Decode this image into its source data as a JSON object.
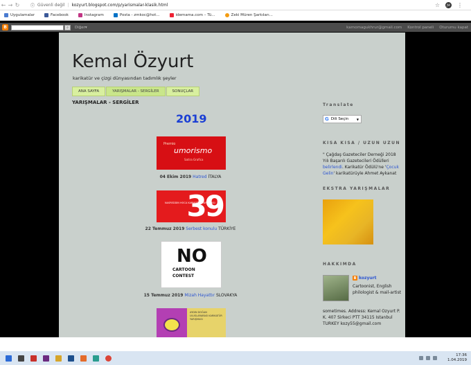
{
  "browser": {
    "security": "Güvenli değil",
    "url": "kozyurt.blogspot.com/p/yarismalar-klasik.html",
    "profile_initials": "JW",
    "bookmarks": [
      "Uygulamalar",
      "Facebook",
      "Instagram",
      "Posta - zmkoc@hot...",
      "idemama.com – Tü...",
      "Zeki Müren Şarkıları..."
    ]
  },
  "navbar": {
    "more": "Diğer",
    "user_email": "karnomagukhrur@gmail.com",
    "control_panel": "Kontrol paneli",
    "sign_out": "Oturumu kapat"
  },
  "blog": {
    "title": "Kemal Özyurt",
    "description": "karikatür ve çizgi dünyasından tadımlık şeyler",
    "tabs": [
      "ANA SAYFA",
      "YARIŞMALAR - SERGİLER",
      "SONUÇLAR"
    ]
  },
  "post": {
    "title": "YARIŞMALAR - SERGİLER",
    "year": "2019",
    "entries": [
      {
        "date": "04 Ekim 2019",
        "link": "Hatred",
        "country": "İTALYA"
      },
      {
        "date": "22 Temmuz 2019",
        "link": "Serbest konulu",
        "country": "TÜRKİYE"
      },
      {
        "date": "15 Temmuz 2019",
        "link": "Mizah Hayattır",
        "country": "SLOVAKYA"
      }
    ],
    "img1": {
      "line1": "Premio",
      "line2": "umorismo",
      "line3": "Satira Grafica"
    },
    "img2": {
      "number": "39",
      "text": "NASREDDIN HOCA KARIKATÜR YARIŞMASI"
    },
    "img3": {
      "big": "NO",
      "line1": "CARTOON",
      "line2": "CONTEST"
    },
    "img4": {
      "text": "AYDIN DOĞAN ULUSLARARASI KARIKATÜR YARIŞMASI"
    }
  },
  "sidebar": {
    "translate_heading": "Translate",
    "translate_button": "Dili Seçin",
    "kisa_heading": "KISA KISA / UZUN UZUN",
    "kisa_text_1": "\" Çağdaş Gazeteciler Derneği 2018 Yılı Başarılı Gazetecileri Ödülleri ",
    "kisa_link_1": "belirlendi",
    "kisa_text_2": ". Karikatür Ödülü'ne '",
    "kisa_link_2": "Çocuk Gelin",
    "kisa_text_3": "' karikatürüyle Ahmet Aykanat",
    "ekstra_heading": "EKSTRA YARIŞMALAR",
    "about_heading": "HAKKIMDA",
    "profile_name": "kozyurt",
    "profile_text": "Cartoonist, English philologist & mail-artist",
    "profile_more": "sometimes. Address: Kemal Ozyurt P. K. 407 Sirkeci PTT 34115 Istanbul TURKEY kozy55@gmail.com"
  },
  "taskbar": {
    "time": "17:36",
    "date": "1.04.2019"
  }
}
